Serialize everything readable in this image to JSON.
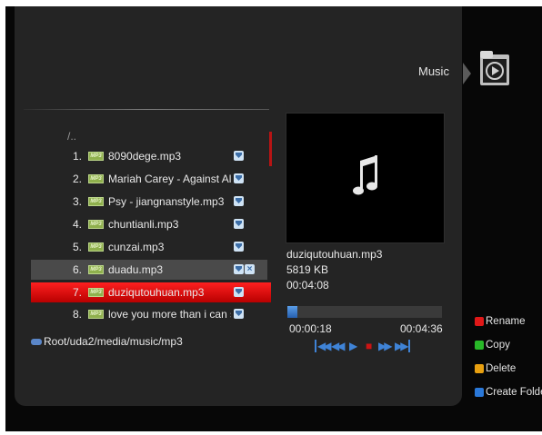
{
  "header": {
    "title": "Music",
    "icon": "music-folder-icon"
  },
  "browser": {
    "parent_label": "/..",
    "files": [
      {
        "num": "1.",
        "type_label": "MP3",
        "name": "8090dege.mp3",
        "fav": true
      },
      {
        "num": "2.",
        "type_label": "MP3",
        "name": "Mariah Carey - Against Al...",
        "fav": true
      },
      {
        "num": "3.",
        "type_label": "MP3",
        "name": "Psy - jiangnanstyle.mp3",
        "fav": true
      },
      {
        "num": "4.",
        "type_label": "MP3",
        "name": "chuntianli.mp3",
        "fav": true
      },
      {
        "num": "5.",
        "type_label": "MP3",
        "name": "cunzai.mp3",
        "fav": true
      },
      {
        "num": "6.",
        "type_label": "MP3",
        "name": "duadu.mp3",
        "fav": true,
        "marked_delete": true,
        "state": "hover"
      },
      {
        "num": "7.",
        "type_label": "MP3",
        "name": "duziqutouhuan.mp3",
        "fav": true,
        "state": "selected"
      },
      {
        "num": "8.",
        "type_label": "MP3",
        "name": "love you more than i can say.",
        "fav": true
      }
    ],
    "path": "Root/uda2/media/music/mp3"
  },
  "player": {
    "filename": "duziqutouhuan.mp3",
    "size": "5819 KB",
    "duration": "00:04:08",
    "current_time": "00:00:18",
    "total_time": "00:04:36",
    "progress": 0.065,
    "controls": [
      {
        "icon": "rewind-to-start-icon",
        "glyph": "◀◀",
        "name": "prev-track-button"
      },
      {
        "icon": "rewind-icon",
        "glyph": "◀◀",
        "name": "rewind-button"
      },
      {
        "icon": "play-icon",
        "glyph": "▶",
        "name": "play-button"
      },
      {
        "icon": "stop-icon",
        "glyph": "■",
        "name": "stop-button"
      },
      {
        "icon": "fast-forward-icon",
        "glyph": "▶▶",
        "name": "forward-button"
      },
      {
        "icon": "skip-to-end-icon",
        "glyph": "▶▶",
        "name": "next-track-button"
      }
    ]
  },
  "legend": [
    {
      "color": "#e01818",
      "label": "Rename"
    },
    {
      "color": "#28b828",
      "label": "Copy"
    },
    {
      "color": "#e8a010",
      "label": "Delete"
    },
    {
      "color": "#2a78d8",
      "label": "Create Folder"
    }
  ],
  "colors": {
    "selection": "#e01010",
    "hover": "#4a4a4a",
    "accent": "#3f83d6"
  }
}
